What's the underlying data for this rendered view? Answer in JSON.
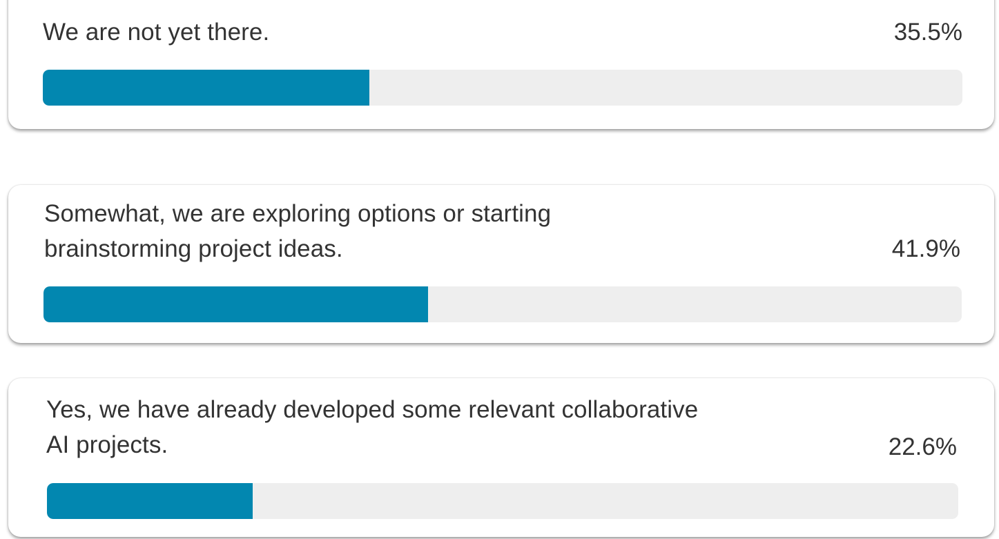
{
  "colors": {
    "bar_fill": "#0287b0",
    "bar_track": "#eeeeee",
    "text": "#333333"
  },
  "options": [
    {
      "label": "We are not yet there.",
      "percent_text": "35.5%",
      "fraction": 0.355
    },
    {
      "label": "Somewhat, we are exploring options or starting\nbrainstorming project ideas.",
      "percent_text": "41.9%",
      "fraction": 0.419
    },
    {
      "label": "Yes, we have already developed some relevant collaborative\nAI projects.",
      "percent_text": "22.6%",
      "fraction": 0.226
    }
  ]
}
